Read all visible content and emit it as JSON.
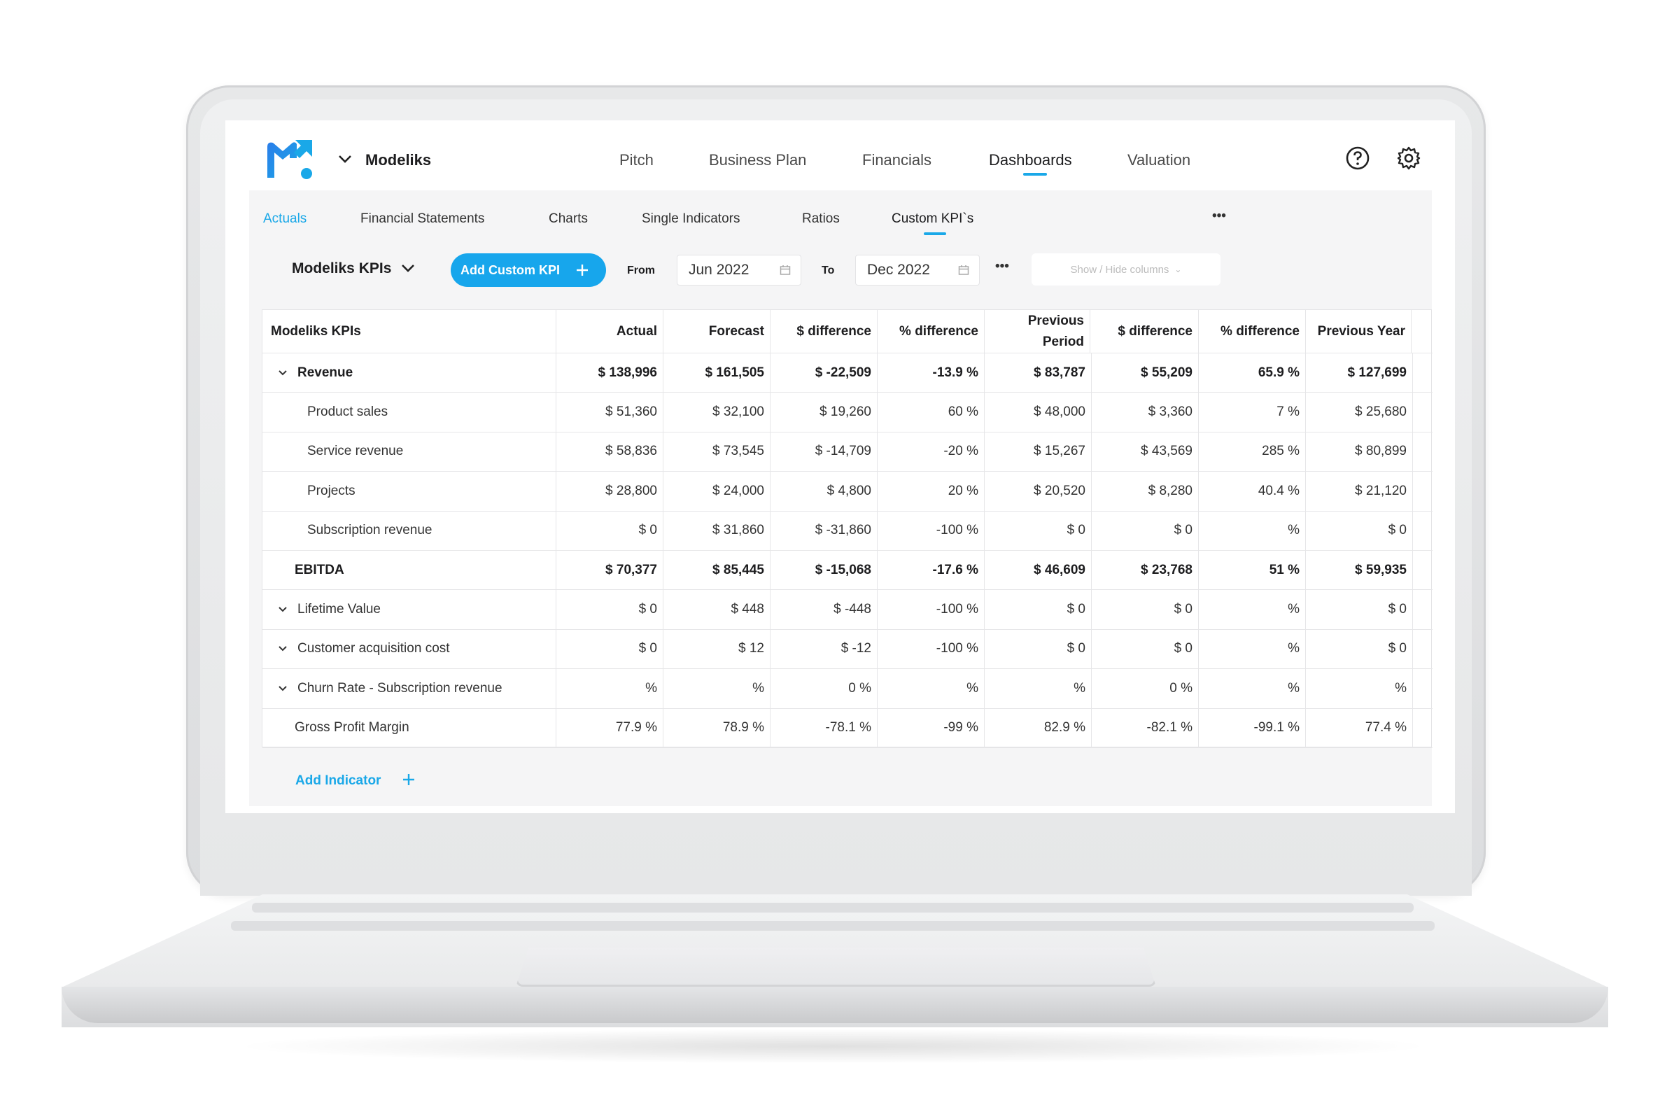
{
  "app": {
    "name": "Modeliks",
    "colors": {
      "accent": "#1aa8e8",
      "button": "#17a6ec",
      "logo": "#1f6fe0"
    }
  },
  "main_nav": [
    "Pitch",
    "Business Plan",
    "Financials",
    "Dashboards",
    "Valuation"
  ],
  "main_nav_active": "Dashboards",
  "icons": {
    "help": "question-circle-icon",
    "settings": "gear-icon"
  },
  "sub_tabs": [
    "Actuals",
    "Financial Statements",
    "Charts",
    "Single Indicators",
    "Ratios",
    "Custom KPI`s"
  ],
  "sub_tab_current": "Custom KPI`s",
  "toolbar": {
    "kpi_set": "Modeliks KPIs",
    "add_kpi": "Add Custom KPI",
    "from_label": "From",
    "from_value": "Jun 2022",
    "to_label": "To",
    "to_value": "Dec 2022",
    "more": "•••",
    "show_hide": "Show / Hide columns"
  },
  "table": {
    "columns": [
      "Modeliks KPIs",
      "Actual",
      "Forecast",
      "$ difference",
      "% difference",
      "Previous Period",
      "$ difference",
      "% difference",
      "Previous Year"
    ],
    "rows": [
      {
        "label": "Revenue",
        "bold": true,
        "expand": true,
        "indent": 0,
        "values": [
          "$ 138,996",
          "$ 161,505",
          "$ -22,509",
          "-13.9 %",
          "$ 83,787",
          "$ 55,209",
          "65.9 %",
          "$ 127,699"
        ]
      },
      {
        "label": "Product sales",
        "bold": false,
        "expand": false,
        "indent": 2,
        "values": [
          "$ 51,360",
          "$ 32,100",
          "$ 19,260",
          "60 %",
          "$ 48,000",
          "$ 3,360",
          "7 %",
          "$ 25,680"
        ]
      },
      {
        "label": "Service revenue",
        "bold": false,
        "expand": false,
        "indent": 2,
        "values": [
          "$ 58,836",
          "$ 73,545",
          "$ -14,709",
          "-20 %",
          "$ 15,267",
          "$ 43,569",
          "285 %",
          "$ 80,899"
        ]
      },
      {
        "label": "Projects",
        "bold": false,
        "expand": false,
        "indent": 2,
        "values": [
          "$ 28,800",
          "$ 24,000",
          "$ 4,800",
          "20 %",
          "$ 20,520",
          "$ 8,280",
          "40.4 %",
          "$ 21,120"
        ]
      },
      {
        "label": "Subscription revenue",
        "bold": false,
        "expand": false,
        "indent": 2,
        "values": [
          "$ 0",
          "$ 31,860",
          "$ -31,860",
          "-100 %",
          "$ 0",
          "$ 0",
          "%",
          "$ 0"
        ]
      },
      {
        "label": "EBITDA",
        "bold": true,
        "expand": false,
        "indent": 1,
        "values": [
          "$ 70,377",
          "$ 85,445",
          "$ -15,068",
          "-17.6 %",
          "$ 46,609",
          "$ 23,768",
          "51 %",
          "$ 59,935"
        ]
      },
      {
        "label": "Lifetime Value",
        "bold": false,
        "expand": true,
        "indent": 0,
        "values": [
          "$ 0",
          "$ 448",
          "$ -448",
          "-100 %",
          "$ 0",
          "$ 0",
          "%",
          "$ 0"
        ]
      },
      {
        "label": "Customer acquisition cost",
        "bold": false,
        "expand": true,
        "indent": 0,
        "values": [
          "$ 0",
          "$ 12",
          "$ -12",
          "-100 %",
          "$ 0",
          "$ 0",
          "%",
          "$ 0"
        ]
      },
      {
        "label": "Churn Rate - Subscription revenue",
        "bold": false,
        "expand": true,
        "indent": 0,
        "values": [
          "%",
          "%",
          "0 %",
          "%",
          "%",
          "0 %",
          "%",
          "%"
        ]
      },
      {
        "label": "Gross Profit Margin",
        "bold": false,
        "expand": false,
        "indent": 1,
        "values": [
          "77.9 %",
          "78.9 %",
          "-78.1 %",
          "-99 %",
          "82.9 %",
          "-82.1 %",
          "-99.1 %",
          "77.4 %"
        ]
      }
    ]
  },
  "add_indicator": "Add Indicator"
}
